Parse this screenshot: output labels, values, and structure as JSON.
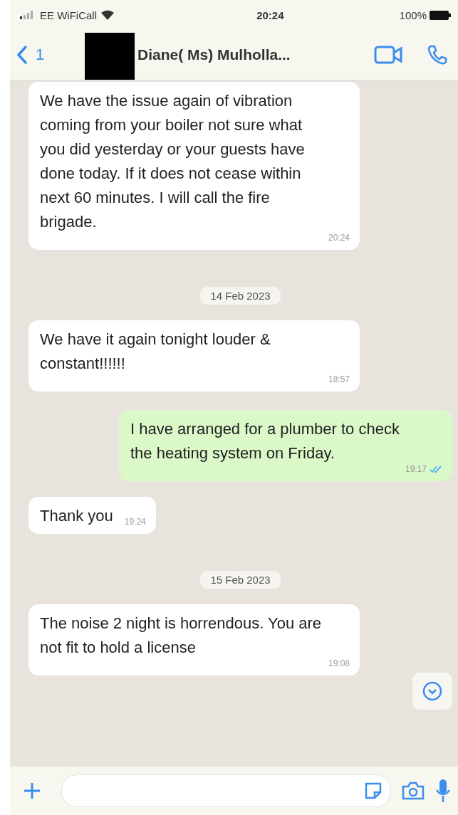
{
  "status_bar": {
    "carrier": "EE WiFiCall",
    "time": "20:24",
    "battery": "100%"
  },
  "header": {
    "back_count": "1",
    "contact_name": "Diane( Ms) Mulholla..."
  },
  "messages": [
    {
      "kind": "incoming",
      "text": "We have the issue again of vibration coming from your boiler not sure what you did yesterday or your guests have done today. If it does not cease within next 60 minutes. I will call the fire brigade.",
      "time": "20:24"
    },
    {
      "kind": "date",
      "text": "14 Feb 2023"
    },
    {
      "kind": "incoming",
      "text": "We have it again tonight louder & constant!!!!!!",
      "time": "18:57"
    },
    {
      "kind": "outgoing",
      "text": "I have arranged for a plumber to check the heating system on Friday.",
      "time": "19:17",
      "read": true
    },
    {
      "kind": "incoming",
      "text": "Thank you",
      "time": "19:24"
    },
    {
      "kind": "date",
      "text": "15 Feb 2023"
    },
    {
      "kind": "incoming",
      "text": "The noise 2 night is horrendous. You are not fit to hold a license",
      "time": "19:08"
    }
  ]
}
